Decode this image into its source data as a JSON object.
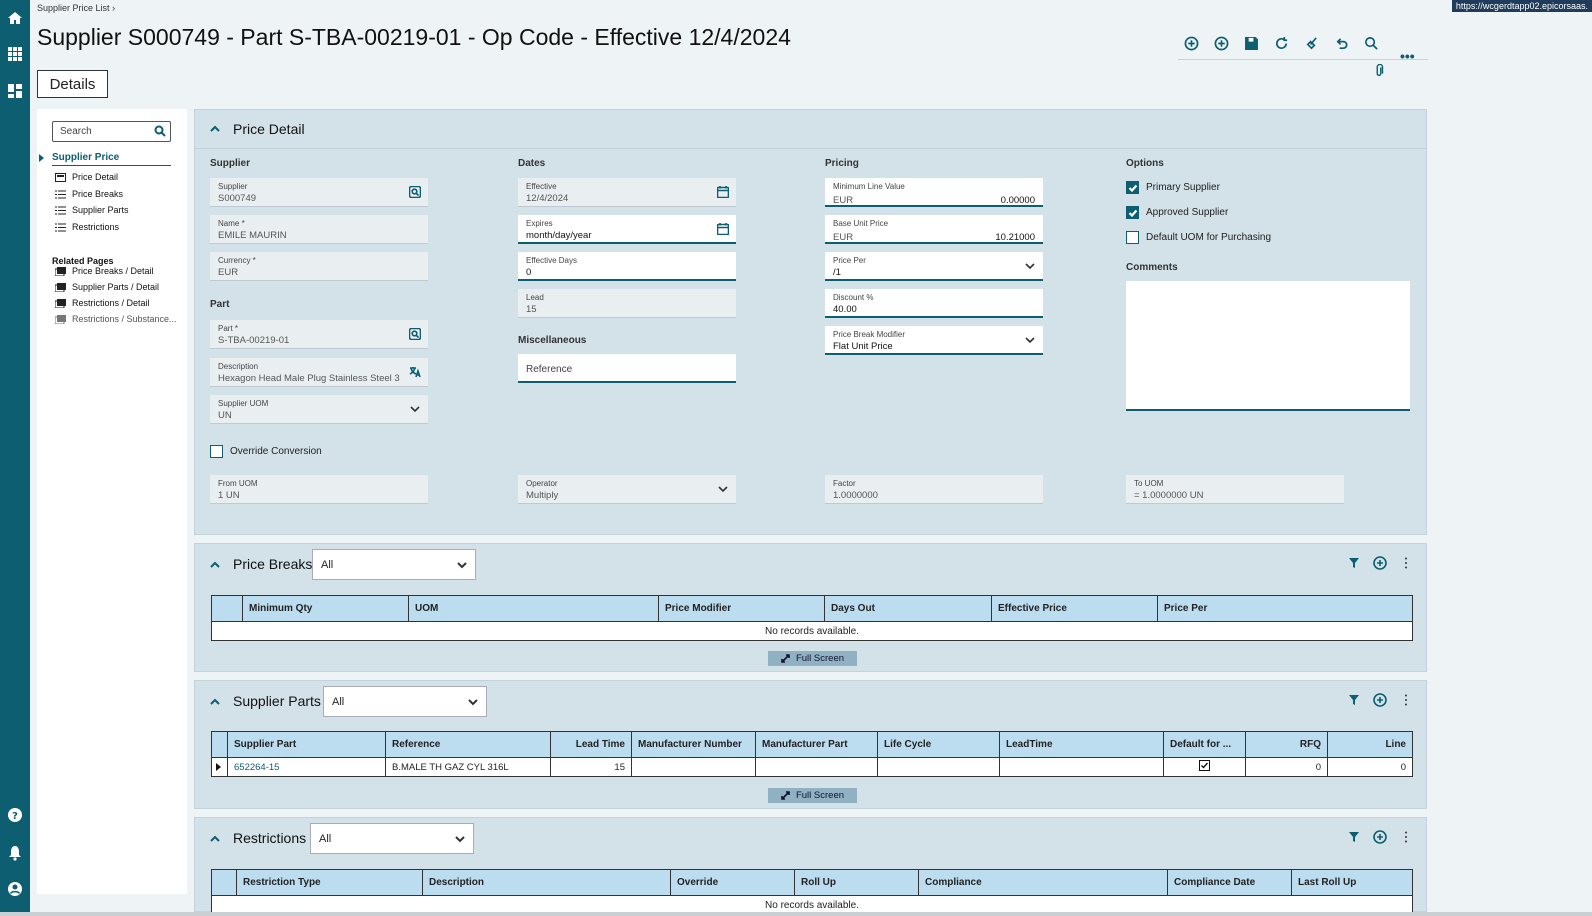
{
  "breadcrumb": {
    "label": "Supplier Price List",
    "sep": "›"
  },
  "url_chip": "https://wcgerdtapp02.epicorsaas.",
  "page_title": "Supplier S000749 - Part S-TBA-00219-01 - Op Code - Effective 12/4/2024",
  "details_tab": "Details",
  "toolbar_more": "•••",
  "nav": {
    "search_placeholder": "Search",
    "root": "Supplier Price",
    "items": [
      "Price Detail",
      "Price Breaks",
      "Supplier Parts",
      "Restrictions"
    ],
    "related_heading": "Related Pages",
    "related": [
      "Price Breaks / Detail",
      "Supplier Parts / Detail",
      "Restrictions / Detail",
      "Restrictions / Substance..."
    ]
  },
  "price_detail": {
    "title": "Price Detail",
    "supplier_section": "Supplier",
    "supplier": {
      "label": "Supplier",
      "value": "S000749"
    },
    "name": {
      "label": "Name *",
      "value": "EMILE MAURIN"
    },
    "currency": {
      "label": "Currency *",
      "value": "EUR"
    },
    "part_section": "Part",
    "part": {
      "label": "Part *",
      "value": "S-TBA-00219-01"
    },
    "description": {
      "label": "Description",
      "value": "Hexagon Head Male Plug Stainless Steel 3"
    },
    "supplier_uom": {
      "label": "Supplier UOM",
      "value": "UN"
    },
    "dates_section": "Dates",
    "effective": {
      "label": "Effective",
      "value": "12/4/2024"
    },
    "expires": {
      "label": "Expires",
      "value": "month/day/year"
    },
    "effective_days": {
      "label": "Effective Days",
      "value": "0"
    },
    "lead": {
      "label": "Lead",
      "value": "15"
    },
    "misc_section": "Miscellaneous",
    "reference_placeholder": "Reference",
    "pricing_section": "Pricing",
    "min_line_value": {
      "label": "Minimum Line Value",
      "currency": "EUR",
      "value": "0.00000"
    },
    "base_unit_price": {
      "label": "Base Unit Price",
      "currency": "EUR",
      "value": "10.21000"
    },
    "price_per": {
      "label": "Price Per",
      "value": "/1"
    },
    "discount": {
      "label": "Discount %",
      "value": "40.00"
    },
    "price_break_modifier": {
      "label": "Price Break Modifier",
      "value": "Flat Unit Price"
    },
    "options_section": "Options",
    "options": [
      {
        "label": "Primary Supplier",
        "checked": true
      },
      {
        "label": "Approved Supplier",
        "checked": true
      },
      {
        "label": "Default UOM for Purchasing",
        "checked": false
      }
    ],
    "comments_label": "Comments",
    "override_conversion": "Override Conversion",
    "from_uom": {
      "label": "From UOM",
      "value": "1 UN"
    },
    "operator": {
      "label": "Operator",
      "value": "Multiply"
    },
    "factor": {
      "label": "Factor",
      "value": "1.0000000"
    },
    "to_uom": {
      "label": "To UOM",
      "value": "= 1.0000000 UN"
    }
  },
  "price_breaks": {
    "title": "Price Breaks",
    "filter": "All",
    "columns": [
      "Minimum Qty",
      "UOM",
      "Price Modifier",
      "Days Out",
      "Effective Price",
      "Price Per"
    ],
    "empty": "No records available.",
    "fullscreen": "Full Screen"
  },
  "supplier_parts": {
    "title": "Supplier Parts",
    "filter": "All",
    "columns": [
      "Supplier Part",
      "Reference",
      "Lead Time",
      "Manufacturer Number",
      "Manufacturer Part",
      "Life Cycle",
      "LeadTime",
      "Default for ...",
      "RFQ",
      "Line"
    ],
    "rows": [
      {
        "supplier_part": "652264-15",
        "reference": "B.MALE TH GAZ CYL 316L",
        "lead_time": "15",
        "manufacturer_number": "",
        "manufacturer_part": "",
        "life_cycle": "",
        "leadtime": "",
        "default_for": true,
        "rfq": "0",
        "line": "0"
      }
    ],
    "fullscreen": "Full Screen"
  },
  "restrictions": {
    "title": "Restrictions",
    "filter": "All",
    "columns": [
      "Restriction Type",
      "Description",
      "Override",
      "Roll Up",
      "Compliance",
      "Compliance Date",
      "Last Roll Up"
    ],
    "empty": "No records available."
  }
}
